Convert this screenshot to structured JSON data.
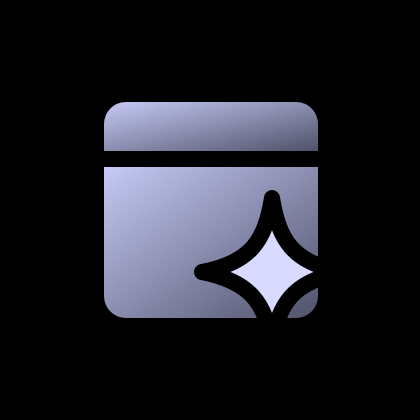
{
  "icon": {
    "name": "window-sparkle-icon",
    "parts": [
      "window-frame-icon",
      "sparkle-icon"
    ]
  },
  "colors": {
    "background": "#000000",
    "window_gradient_light": "#c6caf5",
    "window_gradient_dark": "#4f526a",
    "sparkle_fill": "#d8dbff",
    "outline": "#000000"
  }
}
